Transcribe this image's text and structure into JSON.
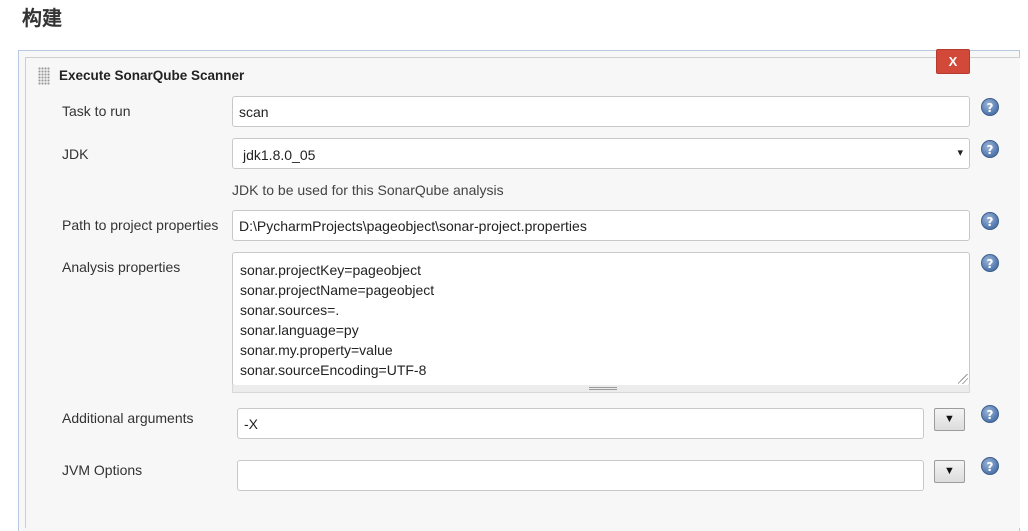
{
  "page": {
    "title": "构建"
  },
  "step": {
    "title": "Execute SonarQube Scanner",
    "delete_label": "X"
  },
  "fields": {
    "task": {
      "label": "Task to run",
      "value": "scan"
    },
    "jdk": {
      "label": "JDK",
      "selected": "jdk1.8.0_05",
      "description": "JDK to be used for this SonarQube analysis"
    },
    "path": {
      "label": "Path to project properties",
      "value": "D:\\PycharmProjects\\pageobject\\sonar-project.properties"
    },
    "analysis": {
      "label": "Analysis properties",
      "lines": [
        "sonar.projectKey=pageobject",
        "sonar.projectName=pageobject",
        "sonar.sources=.",
        "sonar.language=py",
        "sonar.my.property=value",
        "sonar.sourceEncoding=UTF-8"
      ]
    },
    "additional": {
      "label": "Additional arguments",
      "value": "-X"
    },
    "jvm": {
      "label": "JVM Options",
      "value": ""
    }
  },
  "icons": {
    "help": "help-icon",
    "expand": "expand-arrow-icon",
    "select_arrow": "chevron-down-icon",
    "drag": "drag-handle-icon"
  },
  "symbols": {
    "help": "?",
    "expand": "▼",
    "select_arrow": "▾"
  },
  "colors": {
    "delete_button": "#d24939",
    "help_icon": "#5a7fb3",
    "panel_border": "#b8c8e2"
  }
}
